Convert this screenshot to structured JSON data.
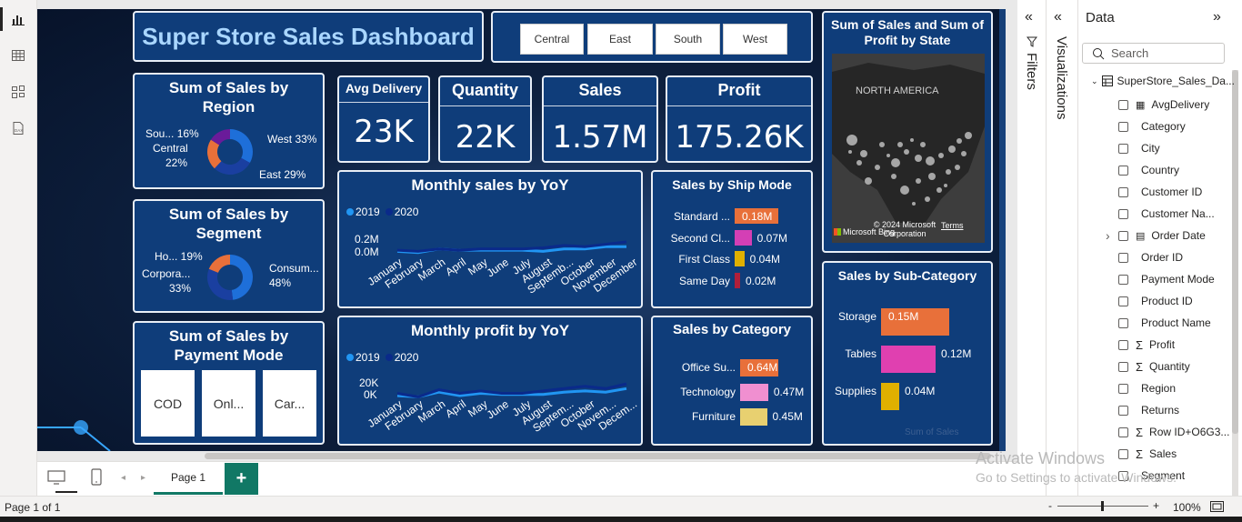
{
  "left_rail": {
    "icons": [
      "report-view-icon",
      "table-view-icon",
      "model-view-icon",
      "dax-query-icon"
    ]
  },
  "dashboard": {
    "title": "Super Store Sales Dashboard",
    "region_slicer": [
      "Central",
      "East",
      "South",
      "West"
    ],
    "kpis": [
      {
        "label": "Avg Delivery",
        "value": "23K"
      },
      {
        "label": "Quantity",
        "value": "22K"
      },
      {
        "label": "Sales",
        "value": "1.57M"
      },
      {
        "label": "Profit",
        "value": "175.26K"
      }
    ],
    "donut_region": {
      "title": "Sum of Sales by Region",
      "labels": [
        {
          "text": "Sou... 16%"
        },
        {
          "text": "Central"
        },
        {
          "text": "22%"
        },
        {
          "text": "West 33%"
        },
        {
          "text": "East 29%"
        }
      ]
    },
    "donut_segment": {
      "title": "Sum of Sales by Segment",
      "labels": [
        {
          "text": "Ho... 19%"
        },
        {
          "text": "Corpora..."
        },
        {
          "text": "33%"
        },
        {
          "text": "Consum..."
        },
        {
          "text": "48%"
        }
      ]
    },
    "payment": {
      "title": "Sum of Sales by Payment Mode",
      "cards": [
        "COD",
        "Onl...",
        "Car..."
      ]
    },
    "monthly_sales": {
      "title": "Monthly sales by YoY",
      "legend": [
        "2019",
        "2020"
      ],
      "yticks": [
        "0.2M",
        "0.0M"
      ]
    },
    "monthly_profit": {
      "title": "Monthly profit by YoY",
      "legend": [
        "2019",
        "2020"
      ],
      "yticks": [
        "20K",
        "0K"
      ]
    },
    "months_sales": [
      "January",
      "February",
      "March",
      "April",
      "May",
      "June",
      "July",
      "August",
      "Septemb...",
      "October",
      "November",
      "December"
    ],
    "months_profit": [
      "January",
      "February",
      "March",
      "April",
      "May",
      "June",
      "July",
      "August",
      "Septem...",
      "October",
      "Novem...",
      "Decem..."
    ],
    "ship_mode": {
      "title": "Sales by Ship Mode"
    },
    "category": {
      "title": "Sales by Category"
    },
    "subcategory": {
      "title": "Sales by Sub-Category",
      "axis_note": "Sum of Sales"
    },
    "map": {
      "title": "Sum of Sales and Sum of Profit by State",
      "region_label": "NORTH AMERICA",
      "credit": "Microsoft Bing",
      "copyright": "© 2024 Microsoft Corporation",
      "terms": "Terms"
    }
  },
  "chart_data": [
    {
      "type": "pie",
      "title": "Sum of Sales by Region",
      "categories": [
        "West",
        "East",
        "Central",
        "South"
      ],
      "values": [
        33,
        29,
        22,
        16
      ],
      "colors": [
        "#1e6fd9",
        "#1a3fa0",
        "#e8703a",
        "#6a1b9a"
      ]
    },
    {
      "type": "pie",
      "title": "Sum of Sales by Segment",
      "categories": [
        "Consumer",
        "Corporate",
        "Home Office"
      ],
      "values": [
        48,
        33,
        19
      ],
      "colors": [
        "#1e6fd9",
        "#1a3fa0",
        "#e8703a"
      ]
    },
    {
      "type": "bar",
      "title": "Sales by Ship Mode",
      "categories": [
        "Standard ...",
        "Second Cl...",
        "First Class",
        "Same Day"
      ],
      "values": [
        0.18,
        0.07,
        0.04,
        0.02
      ],
      "value_labels": [
        "0.18M",
        "0.07M",
        "0.04M",
        "0.02M"
      ],
      "colors": [
        "#e8703a",
        "#d43fb5",
        "#e0b000",
        "#b01f3a"
      ]
    },
    {
      "type": "bar",
      "title": "Sales by Category",
      "categories": [
        "Office Su...",
        "Technology",
        "Furniture"
      ],
      "values": [
        0.64,
        0.47,
        0.45
      ],
      "value_labels": [
        "0.64M",
        "0.47M",
        "0.45M"
      ],
      "colors": [
        "#e8703a",
        "#f08fd0",
        "#e8d070"
      ]
    },
    {
      "type": "bar",
      "title": "Sales by Sub-Category",
      "categories": [
        "Storage",
        "Tables",
        "Supplies"
      ],
      "values": [
        0.15,
        0.12,
        0.04
      ],
      "value_labels": [
        "0.15M",
        "0.12M",
        "0.04M"
      ],
      "colors": [
        "#e8703a",
        "#e040b0",
        "#e0b000"
      ]
    },
    {
      "type": "line",
      "title": "Monthly sales by YoY",
      "x": [
        "January",
        "February",
        "March",
        "April",
        "May",
        "June",
        "July",
        "August",
        "September",
        "October",
        "November",
        "December"
      ],
      "ylim": [
        0,
        0.2
      ],
      "series": [
        {
          "name": "2019",
          "values": [
            0.02,
            0.01,
            0.04,
            0.03,
            0.03,
            0.03,
            0.03,
            0.02,
            0.04,
            0.04,
            0.06,
            0.06
          ]
        },
        {
          "name": "2020",
          "values": [
            0.03,
            0.02,
            0.04,
            0.03,
            0.04,
            0.04,
            0.04,
            0.05,
            0.07,
            0.06,
            0.08,
            0.1
          ]
        }
      ],
      "colors": [
        "#2196f3",
        "#0a2a8a"
      ]
    },
    {
      "type": "line",
      "title": "Monthly profit by YoY",
      "x": [
        "January",
        "February",
        "March",
        "April",
        "May",
        "June",
        "July",
        "August",
        "September",
        "October",
        "November",
        "December"
      ],
      "ylim": [
        0,
        20000
      ],
      "series": [
        {
          "name": "2019",
          "values": [
            3000,
            2000,
            6000,
            3000,
            5000,
            4000,
            4000,
            4000,
            6000,
            7000,
            6000,
            9000
          ]
        },
        {
          "name": "2020",
          "values": [
            5000,
            2000,
            8000,
            5000,
            7000,
            5000,
            5000,
            7000,
            9000,
            11000,
            9000,
            13000
          ]
        }
      ],
      "colors": [
        "#2196f3",
        "#0a2a8a"
      ]
    }
  ],
  "filters_pane": {
    "label": "Filters"
  },
  "viz_pane": {
    "label": "Visualizations"
  },
  "data_pane": {
    "title": "Data",
    "search_placeholder": "Search",
    "table": "SuperStore_Sales_Da...",
    "fields": [
      {
        "name": "AvgDelivery",
        "kind": "calc"
      },
      {
        "name": "Category",
        "kind": ""
      },
      {
        "name": "City",
        "kind": ""
      },
      {
        "name": "Country",
        "kind": ""
      },
      {
        "name": "Customer ID",
        "kind": ""
      },
      {
        "name": "Customer Na...",
        "kind": ""
      },
      {
        "name": "Order Date",
        "kind": "date"
      },
      {
        "name": "Order ID",
        "kind": ""
      },
      {
        "name": "Payment Mode",
        "kind": ""
      },
      {
        "name": "Product ID",
        "kind": ""
      },
      {
        "name": "Product Name",
        "kind": ""
      },
      {
        "name": "Profit",
        "kind": "sum"
      },
      {
        "name": "Quantity",
        "kind": "sum"
      },
      {
        "name": "Region",
        "kind": ""
      },
      {
        "name": "Returns",
        "kind": ""
      },
      {
        "name": "Row ID+O6G3...",
        "kind": "sum"
      },
      {
        "name": "Sales",
        "kind": "sum"
      },
      {
        "name": "Segment",
        "kind": ""
      }
    ]
  },
  "bottom": {
    "page_tab": "Page 1",
    "add": "+"
  },
  "status": {
    "page": "Page 1 of 1",
    "zoom": "100%",
    "minus": "-",
    "plus": "+"
  },
  "watermark": {
    "line1": "Activate Windows",
    "line2": "Go to Settings to activate Windows."
  }
}
